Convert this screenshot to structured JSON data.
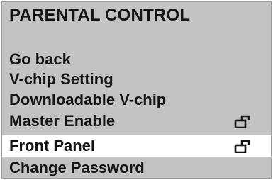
{
  "menu": {
    "title": "PARENTAL CONTROL",
    "items": [
      {
        "label": "Go back",
        "icon": null,
        "selected": false
      },
      {
        "label": "V-chip Setting",
        "icon": null,
        "selected": false
      },
      {
        "label": "Downloadable V-chip",
        "icon": null,
        "selected": false
      },
      {
        "label": "Master Enable",
        "icon": "unlocked-padlock-icon",
        "selected": false
      },
      {
        "label": "Front Panel",
        "icon": "unlocked-padlock-icon",
        "selected": true
      },
      {
        "label": "Change Password",
        "icon": null,
        "selected": false
      }
    ]
  },
  "colors": {
    "menu_background": "#c3c3c3",
    "selected_background": "#ffffff",
    "text": "#141414"
  }
}
